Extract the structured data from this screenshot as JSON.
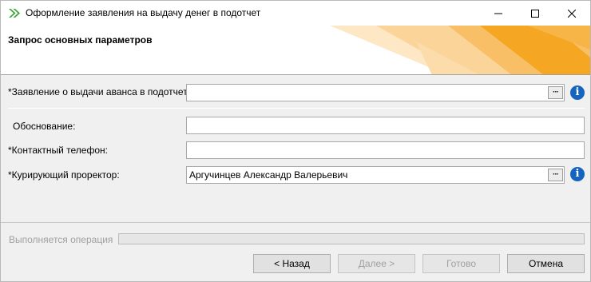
{
  "window": {
    "title": "Оформление заявления на выдачу денег в подотчет"
  },
  "header": {
    "title": "Запрос основных параметров"
  },
  "form": {
    "advance_statement": {
      "label": "*Заявление о выдачи аванса в подотчет:",
      "value": ""
    },
    "justification": {
      "label": "Обоснование:",
      "value": ""
    },
    "phone": {
      "label": "*Контактный телефон:",
      "value": ""
    },
    "prorector": {
      "label": "*Курирующий проректор:",
      "value": "Аргучинцев Александр Валерьевич"
    }
  },
  "status": {
    "label": "Выполняется операция",
    "progress": 0
  },
  "buttons": {
    "back": "< Назад",
    "next": "Далее >",
    "done": "Готово",
    "cancel": "Отмена"
  },
  "colors": {
    "banner_orange": "#f5a623",
    "info_blue": "#1565c0",
    "app_icon_green": "#3aa33a"
  }
}
